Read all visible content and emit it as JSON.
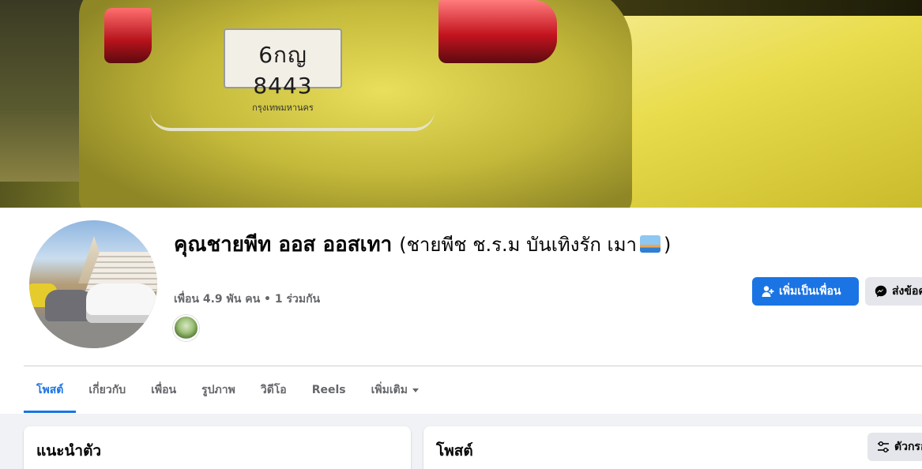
{
  "cover": {
    "plate_number": "6กญ 8443",
    "plate_province": "กรุงเทพมหานคร"
  },
  "profile": {
    "name": "คุณชายพีท ออส ออสเทา",
    "alt_name_open": "(ชายพีช ช.ร.ม บันเทิงรัก",
    "alt_name_close": "เมา",
    "alt_name_end": ")",
    "friends_line": "เพื่อน 4.9 พัน คน • 1 ร่วมกัน"
  },
  "actions": {
    "add_friend": "เพิ่มเป็นเพื่อน",
    "message": "ส่งข้อความ"
  },
  "tabs": [
    {
      "label": "โพสต์",
      "active": true
    },
    {
      "label": "เกี่ยวกับ"
    },
    {
      "label": "เพื่อน"
    },
    {
      "label": "รูปภาพ"
    },
    {
      "label": "วิดีโอ"
    },
    {
      "label": "Reels"
    },
    {
      "label": "เพิ่มเติม"
    }
  ],
  "cards": {
    "intro_title": "แนะนำตัว",
    "posts_title": "โพสต์",
    "filter_label": "ตัวกรอง"
  },
  "colors": {
    "accent": "#1b74e4",
    "background": "#f0f2f5",
    "secondary_text": "#65676b"
  }
}
